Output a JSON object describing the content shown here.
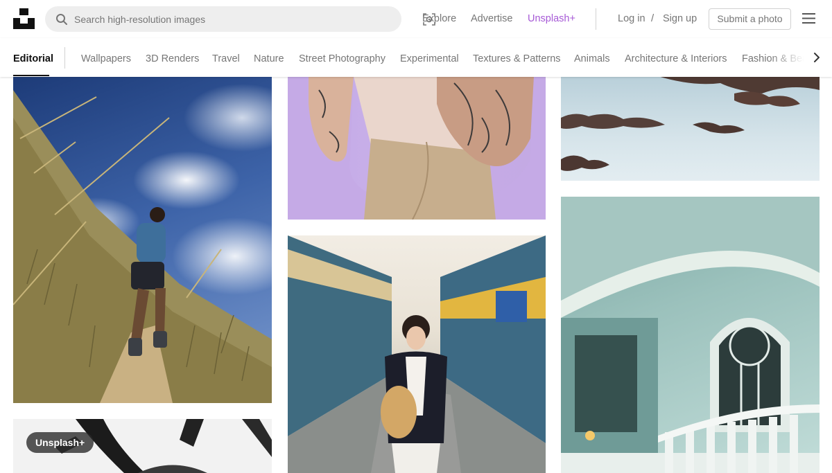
{
  "header": {
    "search": {
      "placeholder": "Search high-resolution images",
      "value": ""
    },
    "nav": {
      "explore": "Explore",
      "advertise": "Advertise",
      "unsplash_plus": "Unsplash+",
      "login": "Log in",
      "separator": "/",
      "signup": "Sign up",
      "submit": "Submit a photo"
    },
    "colors": {
      "unsplash_plus": "#a659d6",
      "text_muted": "#767676"
    }
  },
  "categories": {
    "active": "Editorial",
    "items": [
      "Wallpapers",
      "3D Renders",
      "Travel",
      "Nature",
      "Street Photography",
      "Experimental",
      "Textures & Patterns",
      "Animals",
      "Architecture & Interiors",
      "Fashion & Beauty"
    ]
  },
  "photos": [
    {
      "subject": "hiker-on-grassy-hill"
    },
    {
      "subject": "tattooed-arm-lavender"
    },
    {
      "subject": "snow-and-rocks"
    },
    {
      "subject": "woman-between-trains"
    },
    {
      "subject": "ornate-teal-building"
    },
    {
      "subject": "ink-brush-strokes",
      "badge": "Unsplash+"
    }
  ]
}
